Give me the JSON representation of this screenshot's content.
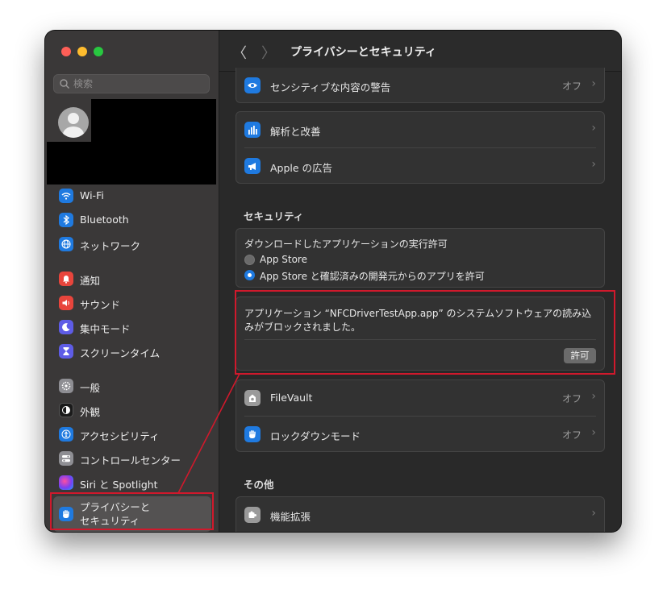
{
  "search": {
    "placeholder": "検索"
  },
  "sidebar": {
    "items": [
      {
        "label": "Wi-Fi"
      },
      {
        "label": "Bluetooth"
      },
      {
        "label": "ネットワーク"
      },
      {
        "label": "通知"
      },
      {
        "label": "サウンド"
      },
      {
        "label": "集中モード"
      },
      {
        "label": "スクリーンタイム"
      },
      {
        "label": "一般"
      },
      {
        "label": "外観"
      },
      {
        "label": "アクセシビリティ"
      },
      {
        "label": "コントロールセンター"
      },
      {
        "label": "Siri と Spotlight"
      },
      {
        "label": "プライバシーと\nセキュリティ"
      }
    ]
  },
  "header": {
    "title": "プライバシーとセキュリティ"
  },
  "privacy": {
    "sensitive_label": "センシティブな内容の警告",
    "sensitive_value": "オフ",
    "analytics_label": "解析と改善",
    "ads_label": "Apple の広告"
  },
  "security": {
    "section_title": "セキュリティ",
    "download_title": "ダウンロードしたアプリケーションの実行許可",
    "option_appstore": "App Store",
    "option_identified": "App Store と確認済みの開発元からのアプリを許可",
    "blocked_line1": "アプリケーション “NFCDriverTestApp.app” のシステムソフトウェアの読み込",
    "blocked_line2": "みがブロックされました。",
    "allow_button": "許可",
    "filevault_label": "FileVault",
    "filevault_value": "オフ",
    "lockdown_label": "ロックダウンモード",
    "lockdown_value": "オフ"
  },
  "other": {
    "section_title": "その他",
    "extensions_label": "機能拡張"
  },
  "colors": {
    "highlight": "#d0192c",
    "accent": "#1f7ae0"
  }
}
